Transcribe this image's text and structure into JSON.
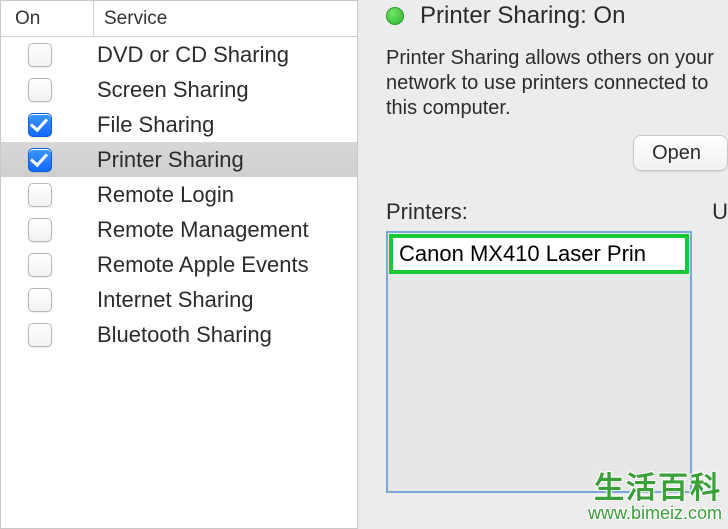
{
  "services": {
    "header_on": "On",
    "header_service": "Service",
    "items": [
      {
        "label": "DVD or CD Sharing",
        "checked": false,
        "selected": false
      },
      {
        "label": "Screen Sharing",
        "checked": false,
        "selected": false
      },
      {
        "label": "File Sharing",
        "checked": true,
        "selected": false
      },
      {
        "label": "Printer Sharing",
        "checked": true,
        "selected": true
      },
      {
        "label": "Remote Login",
        "checked": false,
        "selected": false
      },
      {
        "label": "Remote Management",
        "checked": false,
        "selected": false
      },
      {
        "label": "Remote Apple Events",
        "checked": false,
        "selected": false
      },
      {
        "label": "Internet Sharing",
        "checked": false,
        "selected": false
      },
      {
        "label": "Bluetooth Sharing",
        "checked": false,
        "selected": false
      }
    ]
  },
  "status": {
    "indicator_color": "#2fb52c",
    "text": "Printer Sharing: On"
  },
  "description": "Printer Sharing allows others on your network to use printers connected to this computer.",
  "open_button": "Open",
  "printers_label": "Printers:",
  "users_label": "U",
  "printers": {
    "items": [
      {
        "name": "Canon MX410 Laser Prin",
        "highlighted": true
      }
    ]
  },
  "watermark": {
    "title": "生活百科",
    "url": "www.bimeiz.com"
  }
}
